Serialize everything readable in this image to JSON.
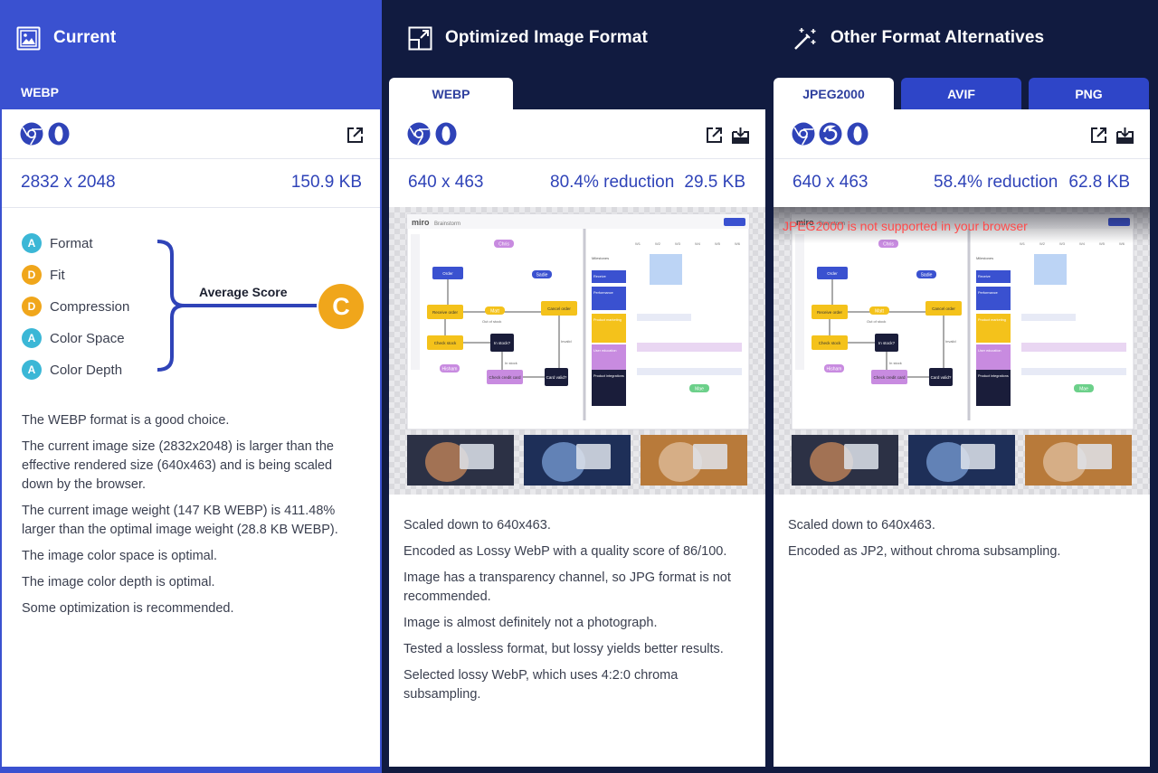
{
  "colors": {
    "accent": "#3a51d0",
    "dark": "#111b40",
    "grade_d": "#f0a61b",
    "grade_a": "#3bb7d6",
    "warning": "#ff4a4a"
  },
  "current": {
    "title": "Current",
    "tab": "WEBP",
    "dimensions": "2832 x 2048",
    "size": "150.9 KB",
    "scores": [
      {
        "grade": "A",
        "label": "Format"
      },
      {
        "grade": "D",
        "label": "Fit"
      },
      {
        "grade": "D",
        "label": "Compression"
      },
      {
        "grade": "A",
        "label": "Color Space"
      },
      {
        "grade": "A",
        "label": "Color Depth"
      }
    ],
    "average_label": "Average Score",
    "average_grade": "C",
    "notes": [
      "The WEBP format is a good choice.",
      "The current image size (2832x2048) is larger than the effective rendered size (640x463) and is being scaled down by the browser.",
      "The current image weight (147 KB WEBP) is 411.48% larger than the optimal image weight (28.8 KB WEBP).",
      "The image color space is optimal.",
      "The image color depth is optimal.",
      "Some optimization is recommended."
    ]
  },
  "optimized": {
    "title": "Optimized Image Format",
    "tab": "WEBP",
    "dimensions": "640 x 463",
    "reduction": "80.4% reduction",
    "size": "29.5 KB",
    "notes": [
      "Scaled down to 640x463.",
      "Encoded as Lossy WebP with a quality score of 86/100.",
      "Image has a transparency channel, so JPG format is not recommended.",
      "Image is almost definitely not a photograph.",
      "Tested a lossless format, but lossy yields better results.",
      "Selected lossy WebP, which uses 4:2:0 chroma subsampling."
    ]
  },
  "alternatives": {
    "title": "Other Format Alternatives",
    "tabs": [
      "JPEG2000",
      "AVIF",
      "PNG"
    ],
    "dimensions": "640 x 463",
    "reduction": "58.4% reduction",
    "size": "62.8 KB",
    "warning": "JPEG2000 is not supported in your browser",
    "notes": [
      "Scaled down to 640x463.",
      "Encoded as JP2, without chroma subsampling."
    ]
  },
  "preview": {
    "brand": "miro",
    "board": "Brainstorm",
    "flow_nodes": [
      "Order",
      "Receive order",
      "Cancel order",
      "Check stock",
      "In stock?",
      "Check credit card",
      "Card valid?"
    ],
    "flow_edge_labels": [
      "Out of stock",
      "In stock",
      "Invalid"
    ],
    "people": [
      "Chris",
      "Sadie",
      "Matt",
      "Hisham",
      "Mae"
    ],
    "timeline_label": "Milestones",
    "timeline_cols": [
      "W1",
      "W2",
      "W3",
      "W4",
      "W5",
      "W6"
    ],
    "timeline_rows": [
      "Receive",
      "Performance",
      "Product marketing",
      "User education",
      "Product integrations"
    ]
  }
}
